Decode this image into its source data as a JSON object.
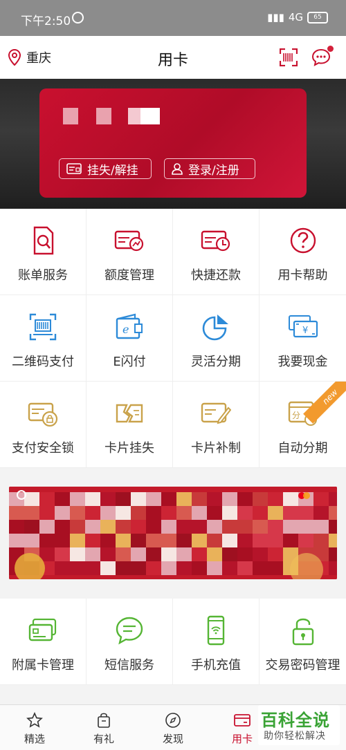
{
  "status": {
    "time": "下午2:50",
    "network": "4G",
    "battery": "65"
  },
  "header": {
    "location": "重庆",
    "title": "用卡"
  },
  "card": {
    "report_loss": "挂失/解挂",
    "login": "登录/注册"
  },
  "services": [
    {
      "label": "账单服务",
      "icon": "bill-icon"
    },
    {
      "label": "额度管理",
      "icon": "credit-limit-icon"
    },
    {
      "label": "快捷还款",
      "icon": "quick-repay-icon"
    },
    {
      "label": "用卡帮助",
      "icon": "help-icon"
    },
    {
      "label": "二维码支付",
      "icon": "qr-pay-icon"
    },
    {
      "label": "E闪付",
      "icon": "e-flash-pay-icon"
    },
    {
      "label": "灵活分期",
      "icon": "pie-chart-icon"
    },
    {
      "label": "我要现金",
      "icon": "cash-icon"
    },
    {
      "label": "支付安全锁",
      "icon": "security-lock-icon"
    },
    {
      "label": "卡片挂失",
      "icon": "card-loss-icon"
    },
    {
      "label": "卡片补制",
      "icon": "card-reissue-icon"
    },
    {
      "label": "自动分期",
      "icon": "auto-installment-icon",
      "badge": "new"
    }
  ],
  "services2": [
    {
      "label": "附属卡管理",
      "icon": "supplementary-card-icon"
    },
    {
      "label": "短信服务",
      "icon": "sms-icon"
    },
    {
      "label": "手机充值",
      "icon": "phone-topup-icon"
    },
    {
      "label": "交易密码管理",
      "icon": "password-lock-icon"
    }
  ],
  "tabs": [
    {
      "label": "精选",
      "icon": "star-icon"
    },
    {
      "label": "有礼",
      "icon": "gift-bag-icon"
    },
    {
      "label": "发现",
      "icon": "compass-icon"
    },
    {
      "label": "用卡",
      "icon": "card-icon",
      "active": true
    }
  ],
  "watermark": {
    "title": "百科全说",
    "subtitle": "助你轻松解决"
  },
  "colors": {
    "brand_red": "#c8102e",
    "gold": "#c9a24a",
    "blue": "#2c8ad8",
    "green": "#55b534"
  }
}
